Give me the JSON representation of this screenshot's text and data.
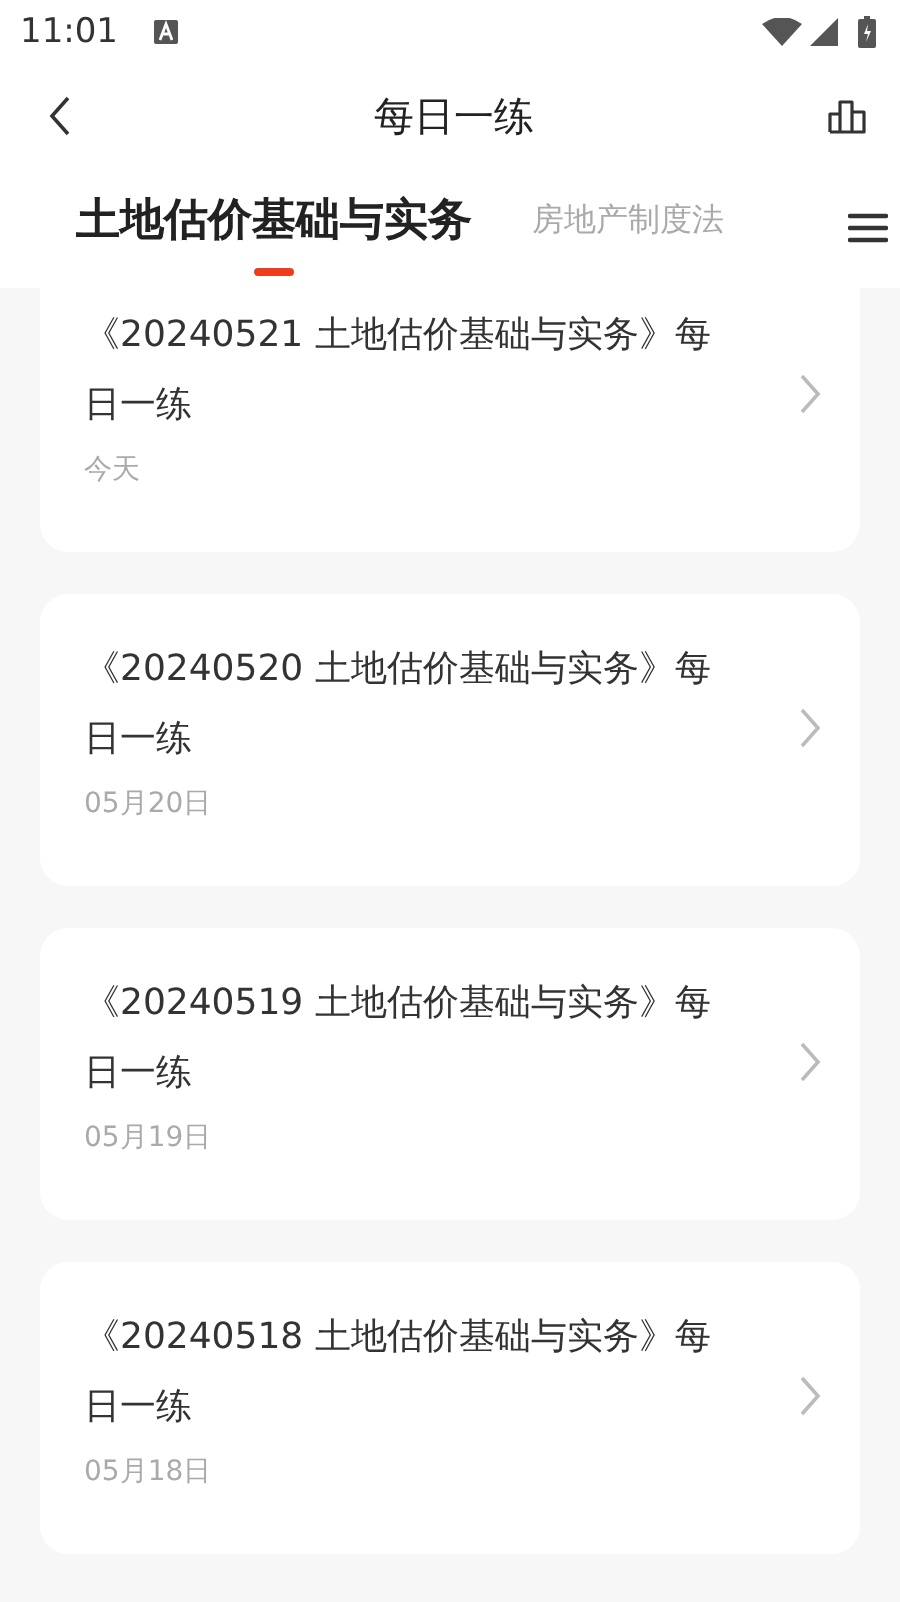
{
  "status_bar": {
    "time": "11:01"
  },
  "header": {
    "title": "每日一练"
  },
  "tabs": [
    {
      "label": "土地估价基础与实务",
      "selected": true
    },
    {
      "label": "房地产制度法",
      "selected": false
    }
  ],
  "items": [
    {
      "title": "《20240521 土地估价基础与实务》每日一练",
      "date": "今天"
    },
    {
      "title": "《20240520 土地估价基础与实务》每日一练",
      "date": "05月20日"
    },
    {
      "title": "《20240519 土地估价基础与实务》每日一练",
      "date": "05月19日"
    },
    {
      "title": "《20240518 土地估价基础与实务》每日一练",
      "date": "05月18日"
    }
  ]
}
